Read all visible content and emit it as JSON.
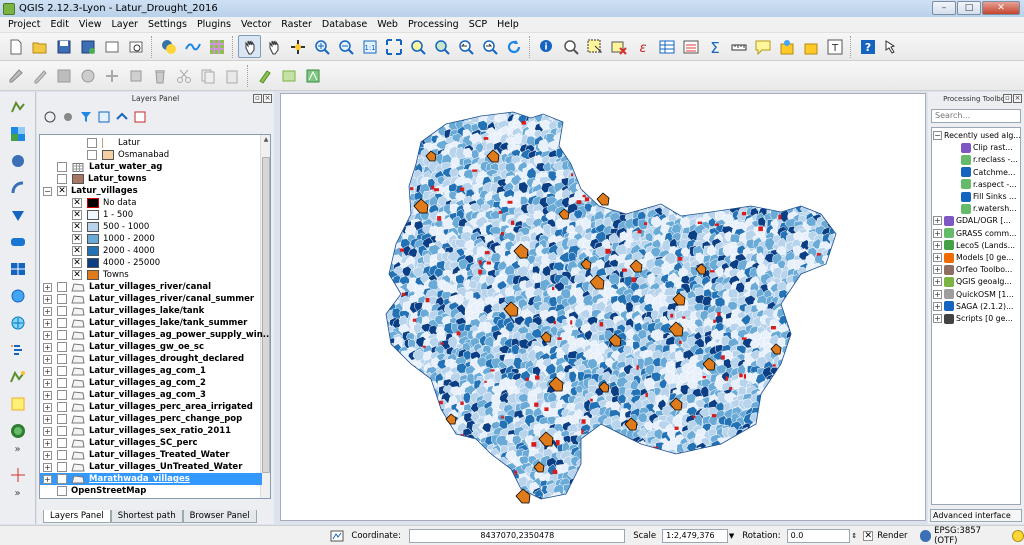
{
  "window": {
    "title": "QGIS 2.12.3-Lyon - Latur_Drought_2016",
    "min": "–",
    "max": "□",
    "close": "✕"
  },
  "menu": [
    "Project",
    "Edit",
    "View",
    "Layer",
    "Settings",
    "Plugins",
    "Vector",
    "Raster",
    "Database",
    "Web",
    "Processing",
    "SCP",
    "Help"
  ],
  "layers_panel": {
    "title": "Layers Panel",
    "layers": [
      {
        "label": "Latur",
        "checked": false,
        "indent": 3,
        "kind": "child-empty"
      },
      {
        "label": "Osmanabad",
        "checked": false,
        "indent": 3,
        "kind": "child-swatch",
        "color": "#f4cfa3"
      },
      {
        "label": "Latur_water_ag",
        "checked": false,
        "indent": 1,
        "kind": "raster",
        "bold": true
      },
      {
        "label": "Latur_towns",
        "checked": false,
        "indent": 1,
        "kind": "swatch",
        "color": "#a87663",
        "bold": true
      },
      {
        "label": "Latur_villages",
        "checked": true,
        "indent": 1,
        "kind": "group",
        "bold": true,
        "expander": "−"
      },
      {
        "label": "No data",
        "checked": true,
        "indent": 2,
        "kind": "swatch",
        "color": "#000000",
        "border": "#d60000"
      },
      {
        "label": "1 - 500",
        "checked": true,
        "indent": 2,
        "kind": "swatch",
        "color": "#f0f6fd"
      },
      {
        "label": "500 - 1000",
        "checked": true,
        "indent": 2,
        "kind": "swatch",
        "color": "#b8d3ec"
      },
      {
        "label": "1000 - 2000",
        "checked": true,
        "indent": 2,
        "kind": "swatch",
        "color": "#6aaad6"
      },
      {
        "label": "2000 - 4000",
        "checked": true,
        "indent": 2,
        "kind": "swatch",
        "color": "#2272b5"
      },
      {
        "label": "4000 - 25000",
        "checked": true,
        "indent": 2,
        "kind": "swatch",
        "color": "#0b3f85"
      },
      {
        "label": "Towns",
        "checked": true,
        "indent": 2,
        "kind": "swatch",
        "color": "#e07b1b"
      },
      {
        "label": "Latur_villages_river/canal",
        "checked": false,
        "indent": 1,
        "kind": "vector",
        "bold": true,
        "expander": "+"
      },
      {
        "label": "Latur_villages_river/canal_summer",
        "checked": false,
        "indent": 1,
        "kind": "vector",
        "bold": true,
        "expander": "+"
      },
      {
        "label": "Latur_villages_lake/tank",
        "checked": false,
        "indent": 1,
        "kind": "vector",
        "bold": true,
        "expander": "+"
      },
      {
        "label": "Latur_villages_lake/tank_summer",
        "checked": false,
        "indent": 1,
        "kind": "vector",
        "bold": true,
        "expander": "+"
      },
      {
        "label": "Latur_villages_ag_power_supply_win...",
        "checked": false,
        "indent": 1,
        "kind": "vector",
        "bold": true,
        "expander": "+"
      },
      {
        "label": "Latur_villages_gw_oe_sc",
        "checked": false,
        "indent": 1,
        "kind": "vector",
        "bold": true,
        "expander": "+"
      },
      {
        "label": "Latur_villages_drought_declared",
        "checked": false,
        "indent": 1,
        "kind": "vector",
        "bold": true,
        "expander": "+"
      },
      {
        "label": "Latur_villages_ag_com_1",
        "checked": false,
        "indent": 1,
        "kind": "vector",
        "bold": true,
        "expander": "+"
      },
      {
        "label": "Latur_villages_ag_com_2",
        "checked": false,
        "indent": 1,
        "kind": "vector",
        "bold": true,
        "expander": "+"
      },
      {
        "label": "Latur_villages_ag_com_3",
        "checked": false,
        "indent": 1,
        "kind": "vector",
        "bold": true,
        "expander": "+"
      },
      {
        "label": "Latur_villages_perc_area_irrigated",
        "checked": false,
        "indent": 1,
        "kind": "vector",
        "bold": true,
        "expander": "+"
      },
      {
        "label": "Latur_villages_perc_change_pop",
        "checked": false,
        "indent": 1,
        "kind": "vector",
        "bold": true,
        "expander": "+"
      },
      {
        "label": "Latur_villages_sex_ratio_2011",
        "checked": false,
        "indent": 1,
        "kind": "vector",
        "bold": true,
        "expander": "+"
      },
      {
        "label": "Latur_villages_SC_perc",
        "checked": false,
        "indent": 1,
        "kind": "vector",
        "bold": true,
        "expander": "+"
      },
      {
        "label": "Latur_villages_Treated_Water",
        "checked": false,
        "indent": 1,
        "kind": "vector",
        "bold": true,
        "expander": "+"
      },
      {
        "label": "Latur_villages_UnTreated_Water",
        "checked": false,
        "indent": 1,
        "kind": "vector",
        "bold": true,
        "expander": "+"
      },
      {
        "label": "Marathwada_villages",
        "checked": true,
        "indent": 1,
        "kind": "vector",
        "bold": true,
        "expander": "+",
        "selected": true
      },
      {
        "label": "OpenStreetMap",
        "checked": false,
        "indent": 1,
        "kind": "none",
        "bold": true
      }
    ],
    "tabs": [
      "Layers Panel",
      "Shortest path",
      "Browser Panel"
    ],
    "active_tab": 0
  },
  "processing": {
    "title": "Processing Toolbox",
    "search_placeholder": "Search...",
    "items": [
      {
        "label": "Recently used alg...",
        "indent": 0,
        "expander": "−",
        "icon": "none"
      },
      {
        "label": "Clip rast...",
        "indent": 2,
        "icon": "gdal"
      },
      {
        "label": "r.reclass -...",
        "indent": 2,
        "icon": "grass"
      },
      {
        "label": "Catchme...",
        "indent": 2,
        "icon": "saga"
      },
      {
        "label": "r.aspect -...",
        "indent": 2,
        "icon": "grass"
      },
      {
        "label": "Fill Sinks ...",
        "indent": 2,
        "icon": "saga"
      },
      {
        "label": "r.watersh...",
        "indent": 2,
        "icon": "grass"
      },
      {
        "label": "GDAL/OGR [...",
        "indent": 0,
        "expander": "+",
        "icon": "gdal"
      },
      {
        "label": "GRASS comm...",
        "indent": 0,
        "expander": "+",
        "icon": "grass"
      },
      {
        "label": "LecoS (Lands...",
        "indent": 0,
        "expander": "+",
        "icon": "lecos"
      },
      {
        "label": "Models [0 ge...",
        "indent": 0,
        "expander": "+",
        "icon": "models"
      },
      {
        "label": "Orfeo Toolbo...",
        "indent": 0,
        "expander": "+",
        "icon": "orfeo"
      },
      {
        "label": "QGIS geoalg...",
        "indent": 0,
        "expander": "+",
        "icon": "qgis"
      },
      {
        "label": "QuickOSM [1...",
        "indent": 0,
        "expander": "+",
        "icon": "osm"
      },
      {
        "label": "SAGA (2.1.2)...",
        "indent": 0,
        "expander": "+",
        "icon": "saga"
      },
      {
        "label": "Scripts [0 ge...",
        "indent": 0,
        "expander": "+",
        "icon": "scripts"
      }
    ],
    "advanced": "Advanced interface"
  },
  "status": {
    "coordinate_label": "Coordinate:",
    "coordinate_value": "8437070,2350478",
    "scale_label": "Scale",
    "scale_value": "1:2,479,376",
    "rotation_label": "Rotation:",
    "rotation_value": "0.0",
    "render_label": "Render",
    "crs_label": "EPSG:3857 (OTF)"
  },
  "map_legend_colors": {
    "class1": "#e8f1fb",
    "class2": "#b8d3ec",
    "class3": "#6aaad6",
    "class4": "#2272b5",
    "class5": "#0b3f85",
    "nodata": "#d81b1b",
    "towns": "#e07b1b"
  }
}
